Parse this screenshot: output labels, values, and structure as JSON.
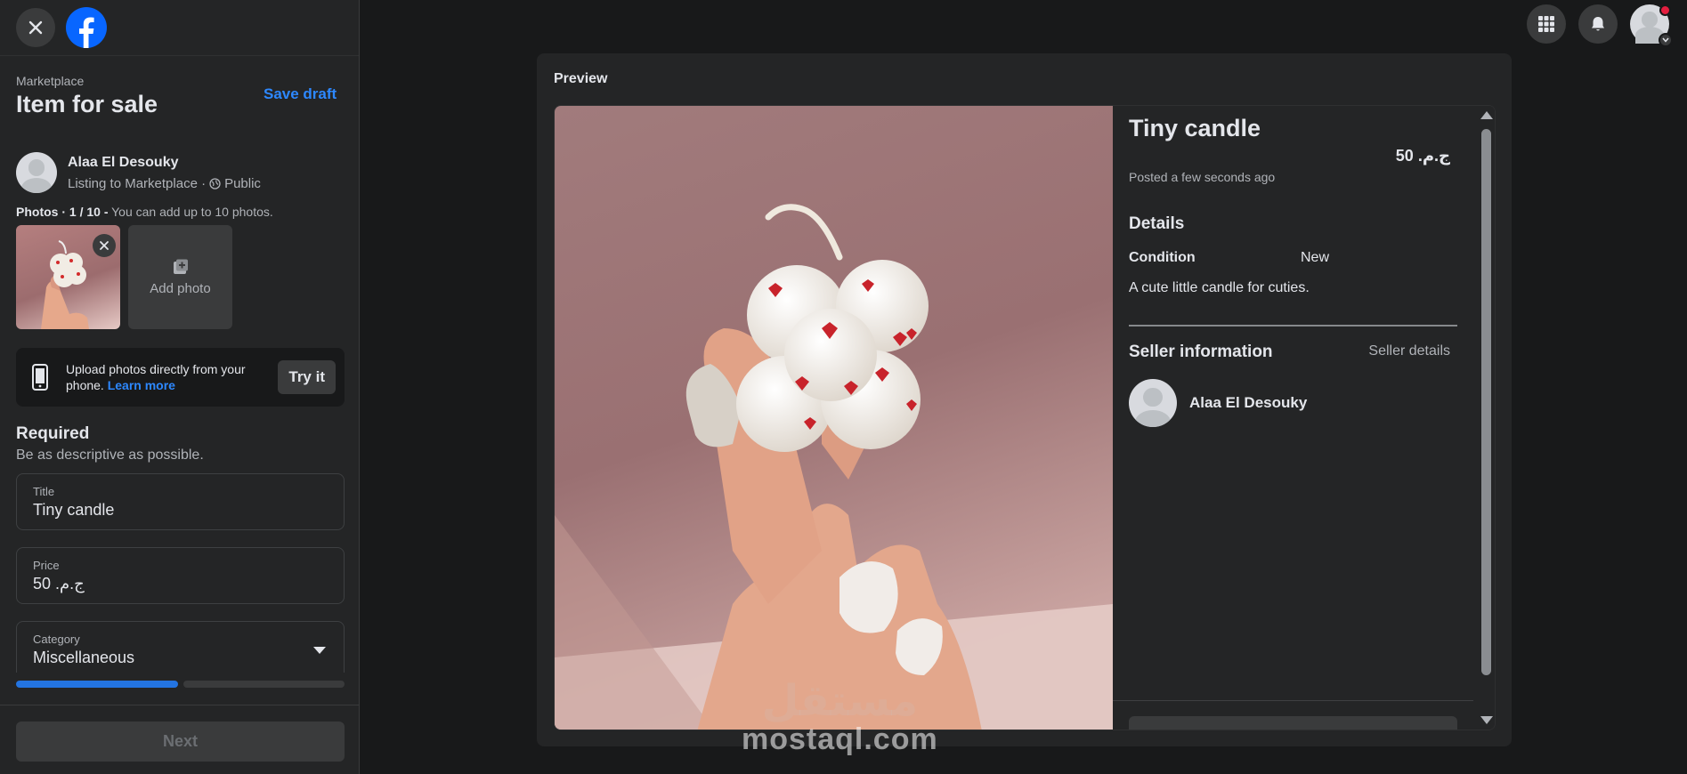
{
  "sidebar": {
    "breadcrumb": "Marketplace",
    "title": "Item for sale",
    "save_draft": "Save draft",
    "seller": {
      "name": "Alaa El Desouky",
      "listing_to": "Listing to Marketplace ·",
      "audience": "Public"
    },
    "photos": {
      "label": "Photos",
      "count": "· 1 / 10 -",
      "note": "You can add up to 10 photos.",
      "add_photo": "Add photo"
    },
    "upload": {
      "text": "Upload photos directly from your phone.",
      "learn_more": "Learn more",
      "try_it": "Try it"
    },
    "required": {
      "heading": "Required",
      "subtitle": "Be as descriptive as possible."
    },
    "fields": {
      "title_label": "Title",
      "title_value": "Tiny candle",
      "price_label": "Price",
      "price_value": "ج.م. 50",
      "category_label": "Category",
      "category_value": "Miscellaneous"
    },
    "progress": {
      "step": 1,
      "total": 2
    },
    "next": "Next"
  },
  "preview": {
    "label": "Preview",
    "title": "Tiny candle",
    "price": "ج.م. 50",
    "posted": "Posted a few seconds ago",
    "details_heading": "Details",
    "condition_label": "Condition",
    "condition_value": "New",
    "description": "A cute little candle for cuties.",
    "seller_info_heading": "Seller information",
    "seller_details_link": "Seller details",
    "seller_name": "Alaa El Desouky"
  },
  "watermark": {
    "arabic": "مستقل",
    "latin": "mostaql.com"
  },
  "icons": [
    "close-icon",
    "facebook-logo-icon",
    "menu-grid-icon",
    "bell-icon",
    "globe-icon",
    "add-photo-icon",
    "phone-icon",
    "chevron-down-icon"
  ],
  "colors": {
    "accent": "#2d88ff",
    "progress": "#2374e1",
    "notification": "#e41e3f",
    "background": "#18191a",
    "surface": "#242526"
  }
}
